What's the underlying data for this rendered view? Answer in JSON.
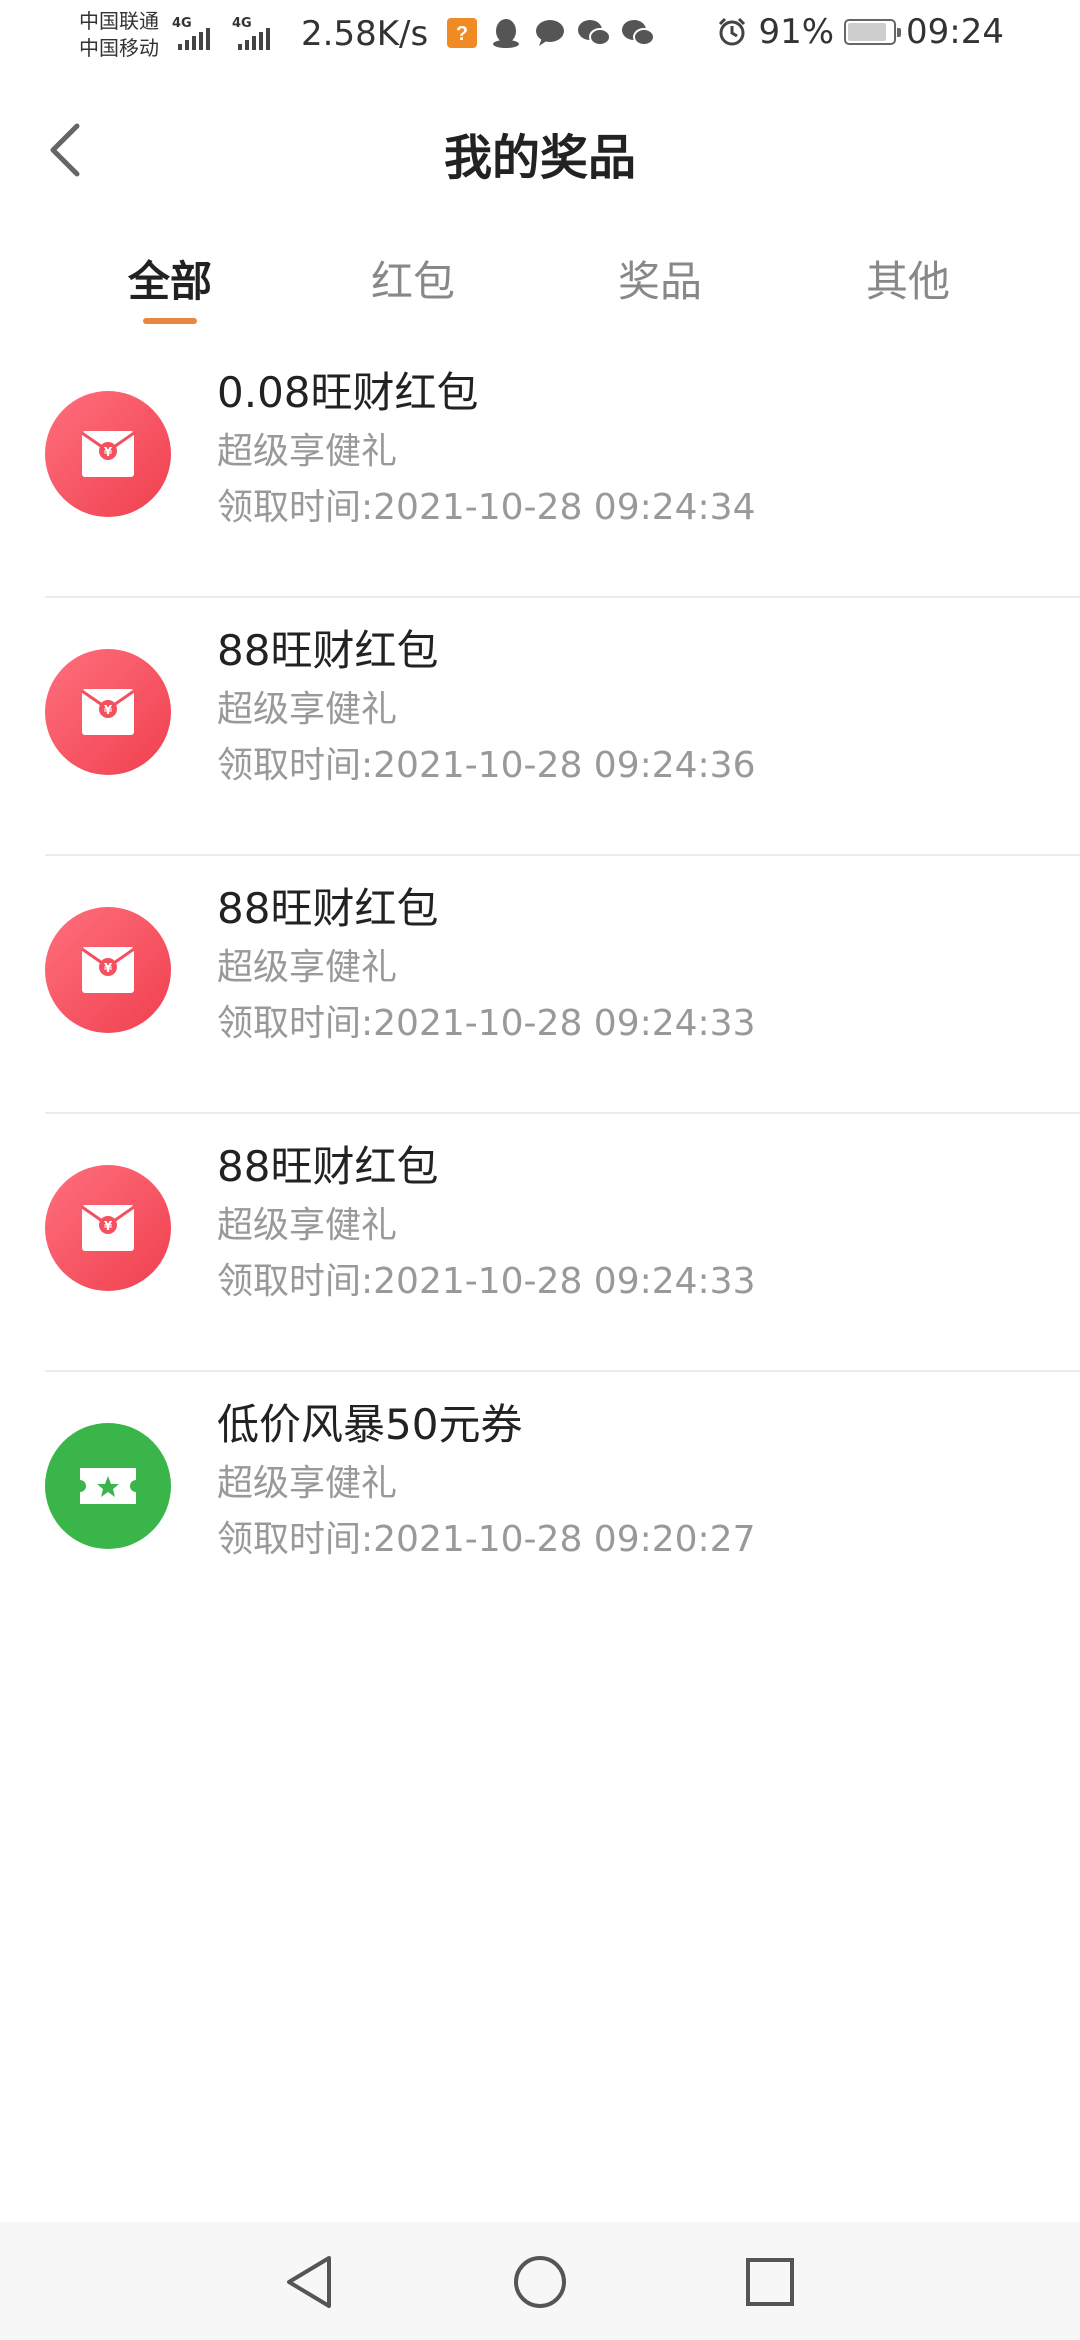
{
  "status_bar": {
    "carrier1": "中国联通",
    "carrier2": "中国移动",
    "network1": "4G",
    "network2": "4G",
    "net_speed": "2.58K/s",
    "battery_percent": "91%",
    "time": "09:24",
    "battery_level": 0.91
  },
  "header": {
    "title": "我的奖品"
  },
  "tabs": [
    {
      "label": "全部",
      "active": true
    },
    {
      "label": "红包",
      "active": false
    },
    {
      "label": "奖品",
      "active": false
    },
    {
      "label": "其他",
      "active": false
    }
  ],
  "items": [
    {
      "title": "0.08旺财红包",
      "subtitle": "超级享健礼",
      "time": "领取时间:2021-10-28 09:24:34",
      "icon": "red-envelope-icon",
      "color": "#f5505e"
    },
    {
      "title": "88旺财红包",
      "subtitle": "超级享健礼",
      "time": "领取时间:2021-10-28 09:24:36",
      "icon": "red-envelope-icon",
      "color": "#f5505e"
    },
    {
      "title": "88旺财红包",
      "subtitle": "超级享健礼",
      "time": "领取时间:2021-10-28 09:24:33",
      "icon": "red-envelope-icon",
      "color": "#f5505e"
    },
    {
      "title": "88旺财红包",
      "subtitle": "超级享健礼",
      "time": "领取时间:2021-10-28 09:24:33",
      "icon": "red-envelope-icon",
      "color": "#f5505e"
    },
    {
      "title": "低价风暴50元券",
      "subtitle": "超级享健礼",
      "time": "领取时间:2021-10-28 09:20:27",
      "icon": "coupon-ticket-icon",
      "color": "#3ab54a"
    }
  ],
  "colors": {
    "accent": "#e9873f",
    "red_envelope": "#f5505e",
    "coupon_green": "#3ab54a"
  }
}
